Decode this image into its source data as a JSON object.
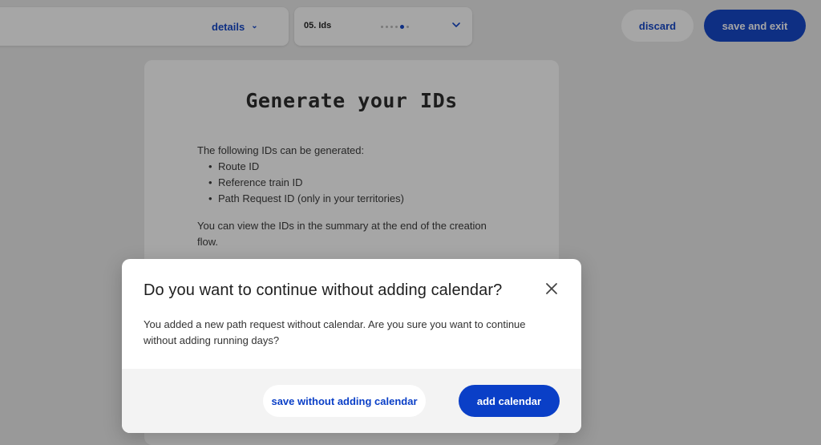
{
  "toolbar": {
    "details_label": "details",
    "step_label": "05. Ids",
    "step_count": 6,
    "current_step": 5,
    "discard_label": "discard",
    "save_exit_label": "save and exit"
  },
  "content": {
    "title": "Generate your IDs",
    "intro": "The following IDs can be generated:",
    "items": [
      "Route ID",
      "Reference train ID",
      "Path Request ID (only in your territories)"
    ],
    "note": "You can view the IDs in the summary at the end of the creation flow."
  },
  "modal": {
    "title": "Do you want to continue without adding calendar?",
    "body": "You added a new path request without calendar. Are you sure you want to continue without adding running days?",
    "secondary_label": "save without adding calendar",
    "primary_label": "add calendar"
  },
  "colors": {
    "accent": "#0a3fc7",
    "overlay": "rgba(20,20,20,0.38)",
    "footer": "#f3f3f3"
  },
  "icons": [
    "chevron-down-icon",
    "close-icon"
  ]
}
